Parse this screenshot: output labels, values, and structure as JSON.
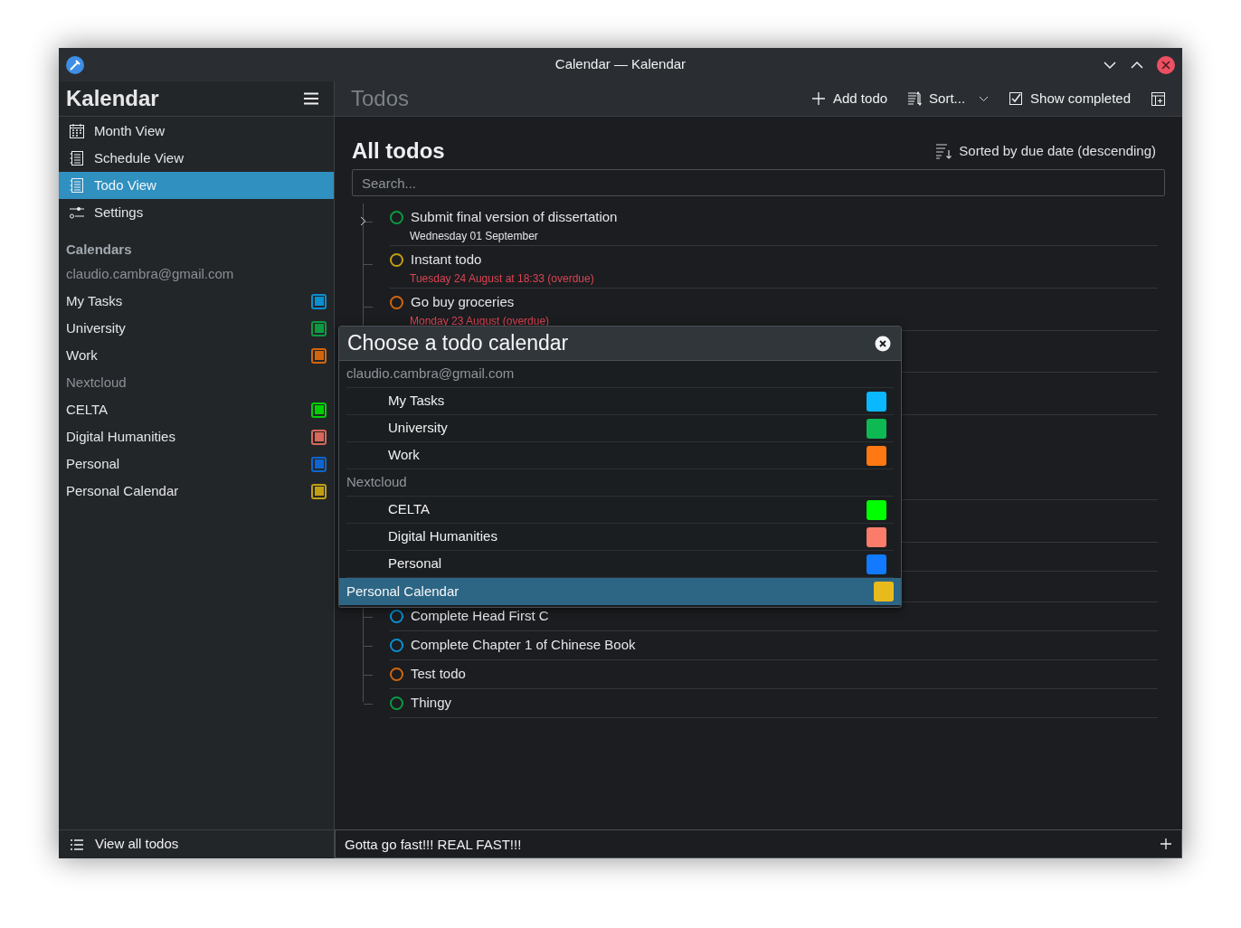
{
  "window": {
    "title": "Calendar — Kalendar"
  },
  "sidebar": {
    "title": "Kalendar",
    "nav": [
      {
        "label": "Month View",
        "selected": false
      },
      {
        "label": "Schedule View",
        "selected": false
      },
      {
        "label": "Todo View",
        "selected": true
      },
      {
        "label": "Settings",
        "selected": false
      }
    ],
    "calendars_heading": "Calendars",
    "calendars": [
      {
        "kind": "header",
        "label": "claudio.cambra@gmail.com"
      },
      {
        "kind": "calendar",
        "label": "My Tasks",
        "color": "#0a8fd0"
      },
      {
        "kind": "calendar",
        "label": "University",
        "color": "#0c9a40"
      },
      {
        "kind": "calendar",
        "label": "Work",
        "color": "#d4650c"
      },
      {
        "kind": "header",
        "label": "Nextcloud"
      },
      {
        "kind": "calendar",
        "label": "CELTA",
        "color": "#00d000"
      },
      {
        "kind": "calendar",
        "label": "Digital Humanities",
        "color": "#d9675a"
      },
      {
        "kind": "calendar",
        "label": "Personal",
        "color": "#0d66d0"
      },
      {
        "kind": "calendar",
        "label": "Personal Calendar",
        "color": "#c39e12"
      }
    ],
    "footer": "View all todos"
  },
  "toolbar": {
    "title": "Todos",
    "actions": [
      {
        "kind": "add",
        "label": "Add todo"
      },
      {
        "kind": "sort",
        "label": "Sort..."
      },
      {
        "kind": "completed",
        "label": "Show completed"
      },
      {
        "kind": "panel"
      }
    ]
  },
  "todos": {
    "heading": "All todos",
    "sort_label": "Sorted by due date (descending)",
    "search": {
      "placeholder": "Search..."
    },
    "items": [
      {
        "title": "Submit final version of dissertation",
        "due": "Wednesday 01 September",
        "overdue": false,
        "color": "#0c9a40",
        "expandable": true
      },
      {
        "title": "Instant todo",
        "due": "Tuesday 24 August at 18:33 (overdue)",
        "overdue": true,
        "color": "#c39e12"
      },
      {
        "title": "Go buy groceries",
        "due": "Monday 23 August (overdue)",
        "overdue": true,
        "color": "#d4650c"
      },
      {
        "kind": "hidden"
      },
      {
        "title": "Complete Head First C",
        "color": "#0a8fd0"
      },
      {
        "title": "Complete Chapter 1 of Chinese Book",
        "color": "#0a8fd0"
      },
      {
        "title": "Test todo",
        "color": "#d4650c"
      },
      {
        "title": "Thingy",
        "color": "#0c9a40"
      }
    ]
  },
  "dialog": {
    "title": "Choose a todo calendar",
    "items": [
      {
        "kind": "header",
        "label": "claudio.cambra@gmail.com"
      },
      {
        "kind": "calendar",
        "label": "My Tasks",
        "color": "#0ab8ff",
        "selected": false
      },
      {
        "kind": "calendar",
        "label": "University",
        "color": "#0db952",
        "selected": false
      },
      {
        "kind": "calendar",
        "label": "Work",
        "color": "#ff7811",
        "selected": false
      },
      {
        "kind": "header",
        "label": "Nextcloud"
      },
      {
        "kind": "calendar",
        "label": "CELTA",
        "color": "#00ff00",
        "selected": false
      },
      {
        "kind": "calendar",
        "label": "Digital Humanities",
        "color": "#fc7c6b",
        "selected": false
      },
      {
        "kind": "calendar",
        "label": "Personal",
        "color": "#117aff",
        "selected": false
      },
      {
        "kind": "top-calendar",
        "label": "Personal Calendar",
        "color": "#e8bb1c",
        "selected": true
      }
    ]
  },
  "quick_add": {
    "value": "Gotta go fast!!! REAL FAST!!!"
  }
}
